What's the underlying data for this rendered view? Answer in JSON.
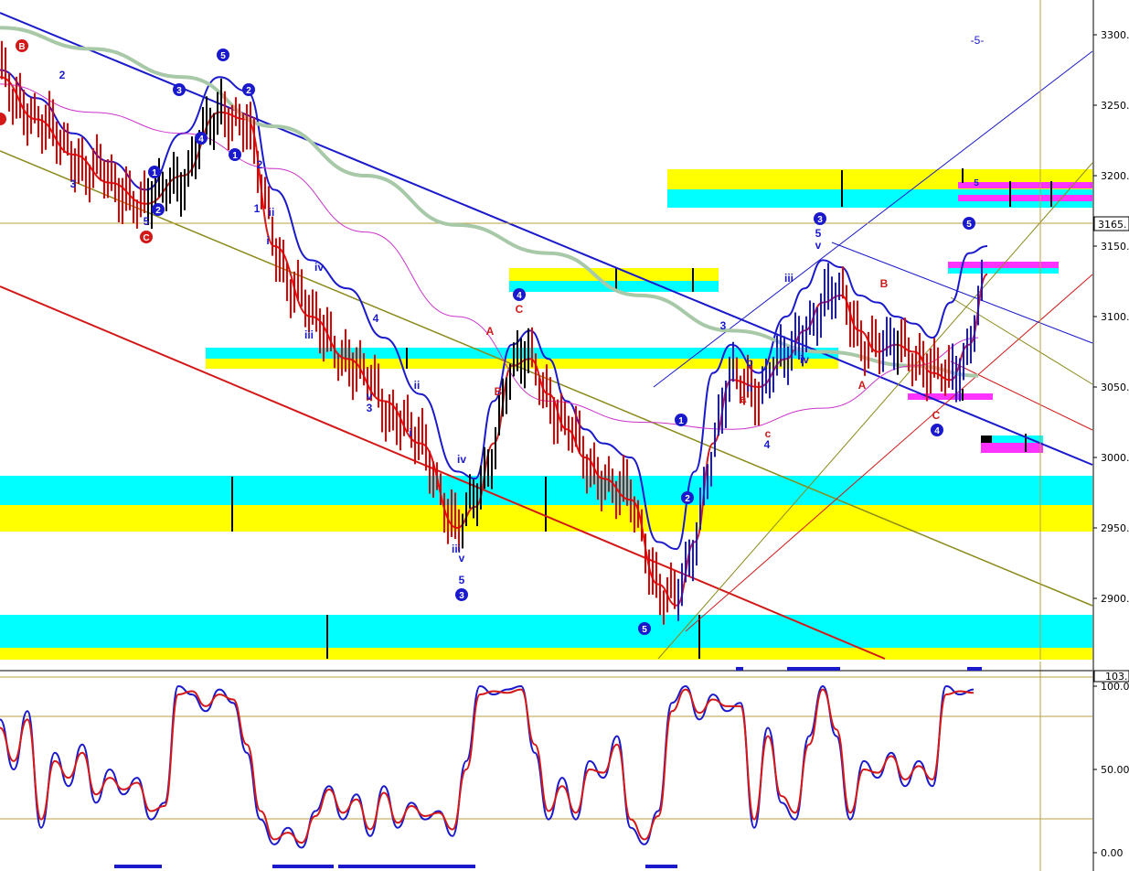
{
  "chart_data": {
    "type": "line",
    "price_panel": {
      "y_ticks": [
        "3300.",
        "3250.",
        "3200.",
        "3150.",
        "3100.",
        "3050.",
        "3000.",
        "2950.",
        "2900."
      ],
      "ylim": [
        2860,
        3330
      ],
      "current_price_label": "3165.",
      "series": [
        {
          "name": "",
          "color": "#1a1acc",
          "x": [
            0,
            40,
            80,
            120,
            160,
            200,
            240,
            270,
            300,
            340,
            380,
            420,
            460,
            500,
            520,
            540,
            560,
            580,
            600,
            620,
            640,
            660,
            690,
            720,
            740,
            760,
            780,
            800,
            830,
            860,
            880,
            900,
            920,
            940,
            960,
            980,
            1000,
            1020,
            1040,
            1060,
            1080
          ],
          "values": [
            3275,
            3255,
            3230,
            3210,
            3190,
            3230,
            3270,
            3260,
            3190,
            3140,
            3120,
            3085,
            3045,
            2990,
            2985,
            3040,
            3080,
            3090,
            3070,
            3040,
            3020,
            3010,
            3000,
            2940,
            2935,
            2990,
            3060,
            3080,
            3060,
            3100,
            3120,
            3140,
            3135,
            3115,
            3110,
            3100,
            3095,
            3085,
            3110,
            3145,
            3150
          ]
        },
        {
          "name": "",
          "color": "#d41818",
          "x": [
            0,
            40,
            80,
            120,
            160,
            200,
            240,
            270,
            300,
            340,
            380,
            420,
            460,
            500,
            520,
            540,
            560,
            580,
            600,
            620,
            640,
            660,
            690,
            720,
            740,
            760,
            780,
            800,
            830,
            860,
            880,
            900,
            920,
            940,
            960,
            980,
            1000,
            1020,
            1040,
            1060,
            1080
          ],
          "values": [
            3270,
            3240,
            3215,
            3195,
            3180,
            3200,
            3245,
            3240,
            3150,
            3100,
            3070,
            3040,
            3010,
            2950,
            2965,
            3010,
            3065,
            3070,
            3045,
            3020,
            3000,
            2985,
            2970,
            2910,
            2895,
            2940,
            3010,
            3055,
            3050,
            3070,
            3090,
            3110,
            3115,
            3090,
            3075,
            3080,
            3075,
            3060,
            3055,
            3080,
            3130
          ]
        },
        {
          "name": "",
          "color": "#a8c9a8",
          "x": [
            0,
            100,
            200,
            300,
            400,
            500,
            600,
            700,
            800,
            900,
            1000,
            1070
          ],
          "values": [
            3305,
            3290,
            3270,
            3235,
            3200,
            3165,
            3145,
            3115,
            3090,
            3075,
            3065,
            3058
          ]
        },
        {
          "name": "",
          "color": "#cc33cc",
          "x": [
            0,
            100,
            200,
            300,
            400,
            500,
            600,
            700,
            800,
            900,
            1000,
            1070
          ],
          "values": [
            3265,
            3245,
            3230,
            3205,
            3160,
            3100,
            3040,
            3025,
            3020,
            3035,
            3065,
            3085
          ]
        }
      ],
      "wave_labels_blue": [
        "5",
        "4",
        "3",
        "2",
        "1",
        "5",
        "1",
        "2",
        "ii",
        "i",
        "iv",
        "iii",
        "v",
        "3",
        "4",
        "ii",
        "v",
        "iii",
        "iv",
        "v",
        "5",
        "3",
        "3",
        "1",
        "2",
        "5",
        "iii",
        "i",
        "iv",
        "v",
        "5",
        "3",
        "4",
        "5",
        "4",
        "-5-",
        "ii",
        "i",
        "iv"
      ],
      "wave_labels_red": [
        "B",
        "C",
        "A",
        "A",
        "C",
        "B",
        "a",
        "c",
        "A",
        "B",
        "C",
        "b"
      ]
    },
    "oscillator_panel": {
      "y_ticks": [
        "100.0",
        "50.00",
        "0.00"
      ],
      "ylim": [
        -5,
        110
      ],
      "current_value_label": "103.",
      "series": [
        {
          "name": "",
          "color": "#1a1acc",
          "x": [
            0,
            15,
            30,
            45,
            60,
            75,
            90,
            105,
            120,
            135,
            150,
            165,
            180,
            195,
            210,
            225,
            240,
            255,
            270,
            285,
            300,
            315,
            330,
            345,
            360,
            375,
            390,
            405,
            420,
            435,
            450,
            465,
            480,
            495,
            510,
            525,
            540,
            555,
            570,
            585,
            600,
            615,
            630,
            645,
            660,
            675,
            690,
            705,
            720,
            735,
            750,
            765,
            780,
            795,
            810,
            825,
            840,
            855,
            870,
            885,
            900,
            915,
            930,
            945,
            960,
            975,
            990,
            1005,
            1020,
            1035,
            1050,
            1065
          ],
          "values": [
            80,
            50,
            85,
            15,
            60,
            40,
            65,
            30,
            50,
            35,
            45,
            20,
            30,
            100,
            95,
            85,
            98,
            90,
            60,
            20,
            5,
            15,
            3,
            25,
            40,
            20,
            35,
            10,
            40,
            15,
            30,
            20,
            25,
            10,
            55,
            100,
            95,
            98,
            100,
            60,
            20,
            45,
            20,
            55,
            45,
            70,
            15,
            5,
            25,
            90,
            100,
            80,
            95,
            85,
            90,
            15,
            75,
            30,
            20,
            70,
            100,
            70,
            20,
            55,
            45,
            60,
            40,
            55,
            40,
            100,
            95,
            98
          ]
        },
        {
          "name": "",
          "color": "#d41818",
          "x": [
            0,
            15,
            30,
            45,
            60,
            75,
            90,
            105,
            120,
            135,
            150,
            165,
            180,
            195,
            210,
            225,
            240,
            255,
            270,
            285,
            300,
            315,
            330,
            345,
            360,
            375,
            390,
            405,
            420,
            435,
            450,
            465,
            480,
            495,
            510,
            525,
            540,
            555,
            570,
            585,
            600,
            615,
            630,
            645,
            660,
            675,
            690,
            705,
            720,
            735,
            750,
            765,
            780,
            795,
            810,
            825,
            840,
            855,
            870,
            885,
            900,
            915,
            930,
            945,
            960,
            975,
            990,
            1005,
            1020,
            1035,
            1050,
            1065
          ],
          "values": [
            75,
            55,
            80,
            20,
            55,
            45,
            60,
            35,
            45,
            38,
            42,
            25,
            28,
            95,
            97,
            88,
            95,
            92,
            65,
            25,
            8,
            12,
            6,
            22,
            38,
            24,
            32,
            14,
            36,
            18,
            28,
            22,
            24,
            14,
            50,
            95,
            97,
            96,
            98,
            65,
            25,
            40,
            24,
            50,
            48,
            65,
            20,
            8,
            22,
            85,
            98,
            84,
            92,
            88,
            88,
            20,
            70,
            34,
            24,
            65,
            98,
            74,
            24,
            50,
            48,
            58,
            44,
            52,
            44,
            95,
            97,
            96
          ]
        }
      ]
    }
  }
}
